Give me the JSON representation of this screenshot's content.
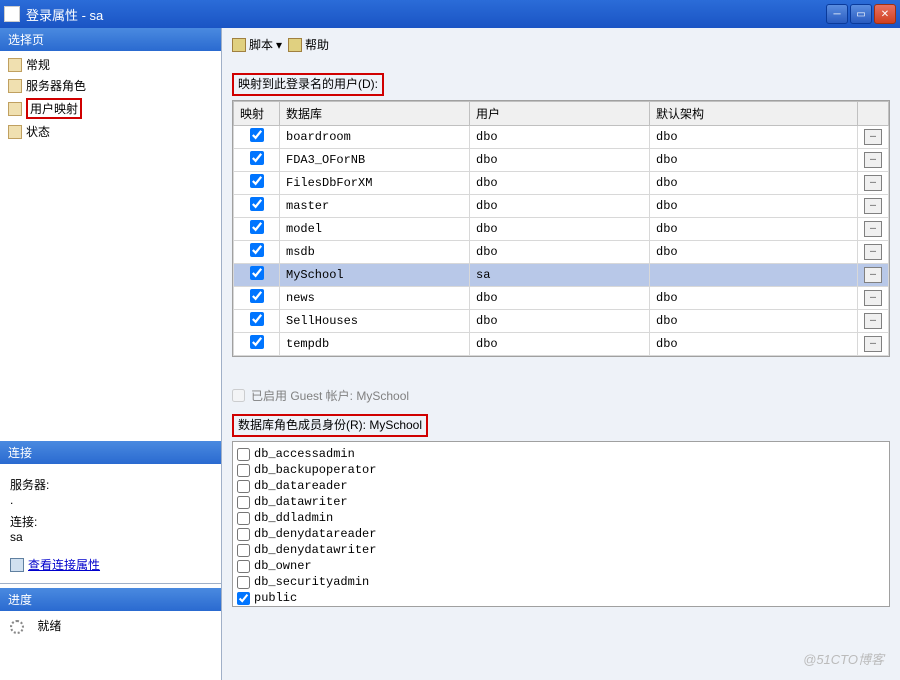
{
  "window": {
    "title": "登录属性 - sa"
  },
  "sidebar": {
    "select_page": "选择页",
    "items": [
      "常规",
      "服务器角色",
      "用户映射",
      "状态"
    ],
    "highlighted_index": 2,
    "connection_header": "连接",
    "server_label": "服务器:",
    "server_value": ".",
    "conn_label": "连接:",
    "conn_value": "sa",
    "view_props": "查看连接属性",
    "progress_header": "进度",
    "progress_status": "就绪"
  },
  "toolbar": {
    "script": "脚本",
    "help": "帮助"
  },
  "mapping": {
    "label": "映射到此登录名的用户(D):",
    "columns": {
      "map": "映射",
      "db": "数据库",
      "user": "用户",
      "schema": "默认架构"
    },
    "rows": [
      {
        "checked": true,
        "db": "boardroom",
        "user": "dbo",
        "schema": "dbo"
      },
      {
        "checked": true,
        "db": "FDA3_OForNB",
        "user": "dbo",
        "schema": "dbo"
      },
      {
        "checked": true,
        "db": "FilesDbForXM",
        "user": "dbo",
        "schema": "dbo"
      },
      {
        "checked": true,
        "db": "master",
        "user": "dbo",
        "schema": "dbo"
      },
      {
        "checked": true,
        "db": "model",
        "user": "dbo",
        "schema": "dbo"
      },
      {
        "checked": true,
        "db": "msdb",
        "user": "dbo",
        "schema": "dbo"
      },
      {
        "checked": true,
        "db": "MySchool",
        "user": "sa",
        "schema": "",
        "selected": true
      },
      {
        "checked": true,
        "db": "news",
        "user": "dbo",
        "schema": "dbo"
      },
      {
        "checked": true,
        "db": "SellHouses",
        "user": "dbo",
        "schema": "dbo"
      },
      {
        "checked": true,
        "db": "tempdb",
        "user": "dbo",
        "schema": "dbo"
      }
    ]
  },
  "guest": {
    "label": "已启用 Guest 帐户: MySchool"
  },
  "roles": {
    "label": "数据库角色成员身份(R): MySchool",
    "items": [
      {
        "name": "db_accessadmin",
        "checked": false
      },
      {
        "name": "db_backupoperator",
        "checked": false
      },
      {
        "name": "db_datareader",
        "checked": false
      },
      {
        "name": "db_datawriter",
        "checked": false
      },
      {
        "name": "db_ddladmin",
        "checked": false
      },
      {
        "name": "db_denydatareader",
        "checked": false
      },
      {
        "name": "db_denydatawriter",
        "checked": false
      },
      {
        "name": "db_owner",
        "checked": false
      },
      {
        "name": "db_securityadmin",
        "checked": false
      },
      {
        "name": "public",
        "checked": true
      }
    ]
  },
  "watermark": "@51CTO博客"
}
